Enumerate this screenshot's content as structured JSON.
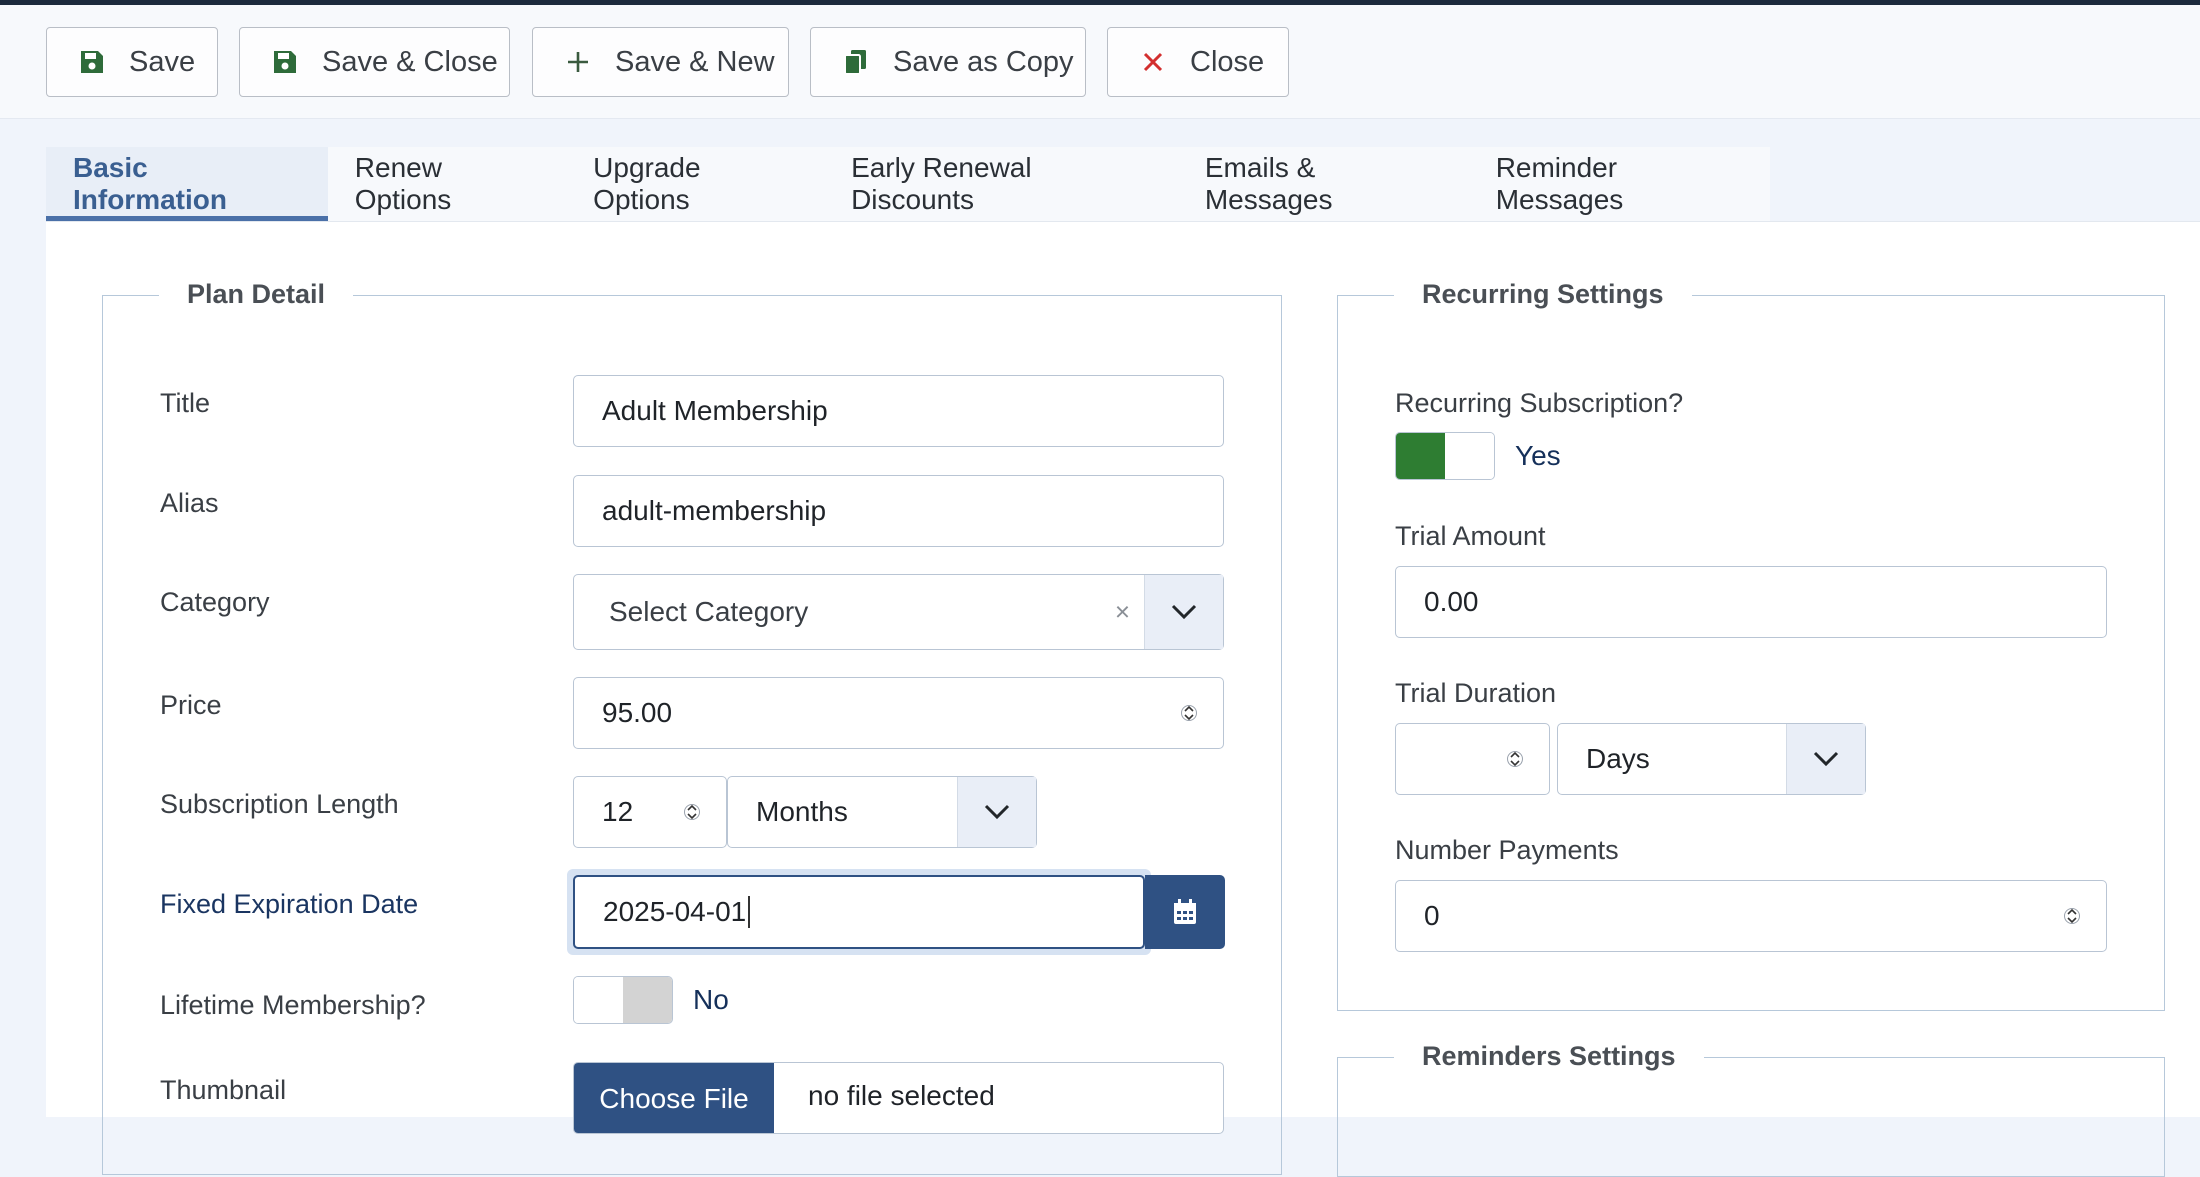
{
  "toolbar": {
    "save": "Save",
    "save_close": "Save & Close",
    "save_new": "Save & New",
    "save_copy": "Save as Copy",
    "close": "Close"
  },
  "tabs": [
    {
      "label": "Basic Information",
      "active": true
    },
    {
      "label": "Renew Options"
    },
    {
      "label": "Upgrade Options"
    },
    {
      "label": "Early Renewal Discounts"
    },
    {
      "label": "Emails & Messages"
    },
    {
      "label": "Reminder Messages"
    }
  ],
  "plan_detail": {
    "legend": "Plan Detail",
    "title_label": "Title",
    "title_value": "Adult Membership",
    "alias_label": "Alias",
    "alias_value": "adult-membership",
    "category_label": "Category",
    "category_value": "Select Category",
    "category_clear": "×",
    "price_label": "Price",
    "price_value": "95.00",
    "sub_length_label": "Subscription Length",
    "sub_length_value": "12",
    "sub_length_unit": "Months",
    "fixed_exp_label": "Fixed Expiration Date",
    "fixed_exp_value": "2025-04-01",
    "lifetime_label": "Lifetime Membership?",
    "lifetime_value": "No",
    "thumbnail_label": "Thumbnail",
    "choose_file": "Choose File",
    "no_file": "no file selected"
  },
  "recurring": {
    "legend": "Recurring Settings",
    "recurring_label": "Recurring Subscription?",
    "recurring_value": "Yes",
    "trial_amount_label": "Trial Amount",
    "trial_amount_value": "0.00",
    "trial_duration_label": "Trial Duration",
    "trial_duration_value": "",
    "trial_duration_unit": "Days",
    "num_payments_label": "Number Payments",
    "num_payments_value": "0"
  },
  "reminders": {
    "legend": "Reminders Settings"
  },
  "colors": {
    "toggle_on": "#2e7d32",
    "toggle_off": "#d3d3d3",
    "accent": "#2f5183",
    "close_x": "#d32f2f"
  }
}
